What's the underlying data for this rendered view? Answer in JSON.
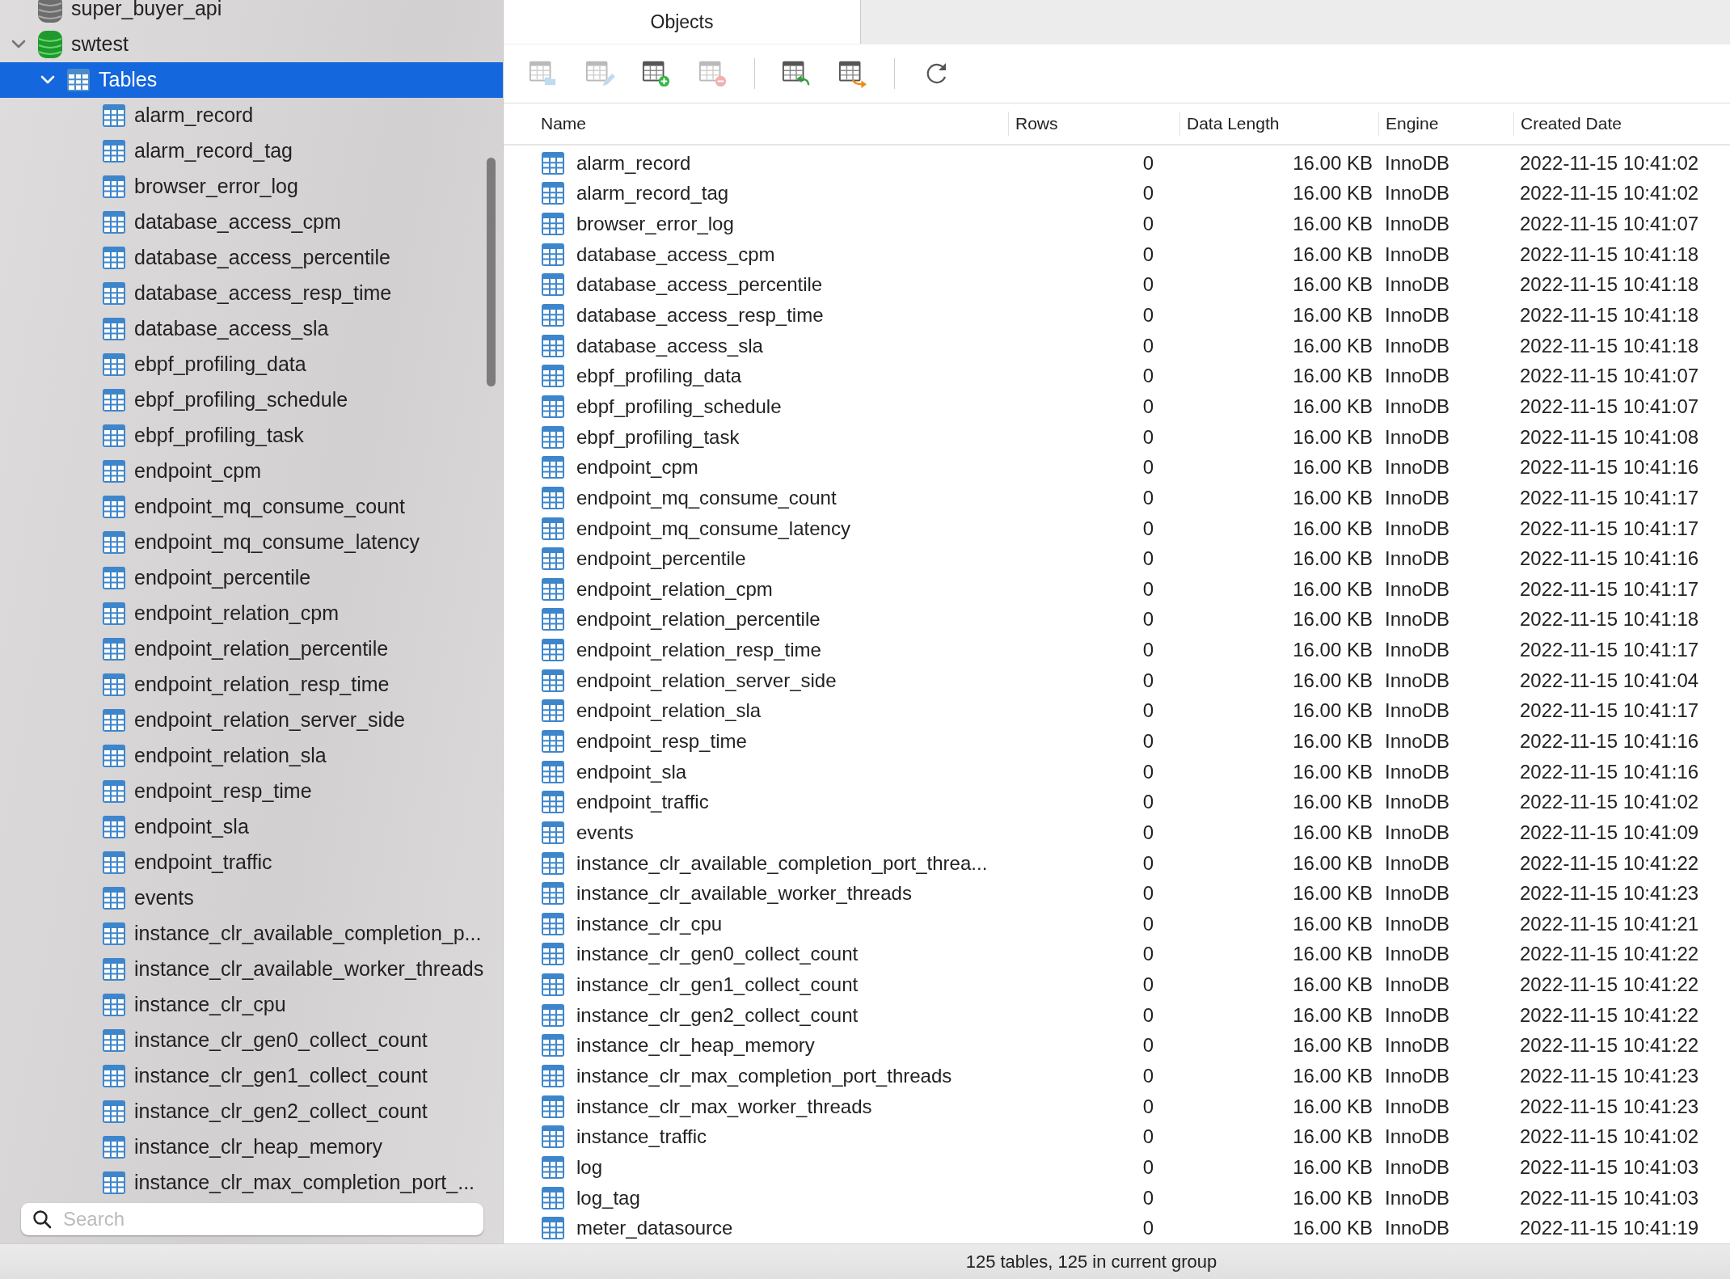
{
  "sidebar": {
    "tree": [
      {
        "name": "super_buyer_api",
        "kind": "database",
        "open": false,
        "selected": false
      },
      {
        "name": "swtest",
        "kind": "database",
        "open": true,
        "expanded": true,
        "selected": false,
        "children": [
          {
            "name": "Tables",
            "kind": "group",
            "expanded": true,
            "selected": true,
            "children": [
              {
                "name": "alarm_record",
                "kind": "table",
                "selected": false
              },
              {
                "name": "alarm_record_tag",
                "kind": "table",
                "selected": false
              },
              {
                "name": "browser_error_log",
                "kind": "table",
                "selected": false
              },
              {
                "name": "database_access_cpm",
                "kind": "table",
                "selected": false
              },
              {
                "name": "database_access_percentile",
                "kind": "table",
                "selected": false
              },
              {
                "name": "database_access_resp_time",
                "kind": "table",
                "selected": false
              },
              {
                "name": "database_access_sla",
                "kind": "table",
                "selected": false
              },
              {
                "name": "ebpf_profiling_data",
                "kind": "table",
                "selected": false
              },
              {
                "name": "ebpf_profiling_schedule",
                "kind": "table",
                "selected": false
              },
              {
                "name": "ebpf_profiling_task",
                "kind": "table",
                "selected": false
              },
              {
                "name": "endpoint_cpm",
                "kind": "table",
                "selected": false
              },
              {
                "name": "endpoint_mq_consume_count",
                "kind": "table",
                "selected": false
              },
              {
                "name": "endpoint_mq_consume_latency",
                "kind": "table",
                "selected": false
              },
              {
                "name": "endpoint_percentile",
                "kind": "table",
                "selected": false
              },
              {
                "name": "endpoint_relation_cpm",
                "kind": "table",
                "selected": false
              },
              {
                "name": "endpoint_relation_percentile",
                "kind": "table",
                "selected": false
              },
              {
                "name": "endpoint_relation_resp_time",
                "kind": "table",
                "selected": false
              },
              {
                "name": "endpoint_relation_server_side",
                "kind": "table",
                "selected": false
              },
              {
                "name": "endpoint_relation_sla",
                "kind": "table",
                "selected": false
              },
              {
                "name": "endpoint_resp_time",
                "kind": "table",
                "selected": false
              },
              {
                "name": "endpoint_sla",
                "kind": "table",
                "selected": false
              },
              {
                "name": "endpoint_traffic",
                "kind": "table",
                "selected": false
              },
              {
                "name": "events",
                "kind": "table",
                "selected": false
              },
              {
                "name": "instance_clr_available_completion_p...",
                "kind": "table",
                "selected": false
              },
              {
                "name": "instance_clr_available_worker_threads",
                "kind": "table",
                "selected": false
              },
              {
                "name": "instance_clr_cpu",
                "kind": "table",
                "selected": false
              },
              {
                "name": "instance_clr_gen0_collect_count",
                "kind": "table",
                "selected": false
              },
              {
                "name": "instance_clr_gen1_collect_count",
                "kind": "table",
                "selected": false
              },
              {
                "name": "instance_clr_gen2_collect_count",
                "kind": "table",
                "selected": false
              },
              {
                "name": "instance_clr_heap_memory",
                "kind": "table",
                "selected": false
              },
              {
                "name": "instance_clr_max_completion_port_...",
                "kind": "table",
                "selected": false
              }
            ]
          }
        ]
      }
    ],
    "search": {
      "placeholder": "Search"
    }
  },
  "tabs": [
    {
      "label": "Objects",
      "selected": true
    }
  ],
  "toolbar": [
    {
      "kind": "open",
      "disabled": true
    },
    {
      "kind": "design",
      "disabled": true
    },
    {
      "kind": "new",
      "disabled": false
    },
    {
      "kind": "delete",
      "disabled": true
    },
    {
      "kind": "separator"
    },
    {
      "kind": "import",
      "disabled": false
    },
    {
      "kind": "export",
      "disabled": false
    },
    {
      "kind": "separator"
    },
    {
      "kind": "refresh",
      "disabled": false
    }
  ],
  "table": {
    "columns": [
      "Name",
      "Rows",
      "Data Length",
      "Engine",
      "Created Date"
    ],
    "rows": [
      [
        "alarm_record",
        "0",
        "16.00 KB",
        "InnoDB",
        "2022-11-15 10:41:02"
      ],
      [
        "alarm_record_tag",
        "0",
        "16.00 KB",
        "InnoDB",
        "2022-11-15 10:41:02"
      ],
      [
        "browser_error_log",
        "0",
        "16.00 KB",
        "InnoDB",
        "2022-11-15 10:41:07"
      ],
      [
        "database_access_cpm",
        "0",
        "16.00 KB",
        "InnoDB",
        "2022-11-15 10:41:18"
      ],
      [
        "database_access_percentile",
        "0",
        "16.00 KB",
        "InnoDB",
        "2022-11-15 10:41:18"
      ],
      [
        "database_access_resp_time",
        "0",
        "16.00 KB",
        "InnoDB",
        "2022-11-15 10:41:18"
      ],
      [
        "database_access_sla",
        "0",
        "16.00 KB",
        "InnoDB",
        "2022-11-15 10:41:18"
      ],
      [
        "ebpf_profiling_data",
        "0",
        "16.00 KB",
        "InnoDB",
        "2022-11-15 10:41:07"
      ],
      [
        "ebpf_profiling_schedule",
        "0",
        "16.00 KB",
        "InnoDB",
        "2022-11-15 10:41:07"
      ],
      [
        "ebpf_profiling_task",
        "0",
        "16.00 KB",
        "InnoDB",
        "2022-11-15 10:41:08"
      ],
      [
        "endpoint_cpm",
        "0",
        "16.00 KB",
        "InnoDB",
        "2022-11-15 10:41:16"
      ],
      [
        "endpoint_mq_consume_count",
        "0",
        "16.00 KB",
        "InnoDB",
        "2022-11-15 10:41:17"
      ],
      [
        "endpoint_mq_consume_latency",
        "0",
        "16.00 KB",
        "InnoDB",
        "2022-11-15 10:41:17"
      ],
      [
        "endpoint_percentile",
        "0",
        "16.00 KB",
        "InnoDB",
        "2022-11-15 10:41:16"
      ],
      [
        "endpoint_relation_cpm",
        "0",
        "16.00 KB",
        "InnoDB",
        "2022-11-15 10:41:17"
      ],
      [
        "endpoint_relation_percentile",
        "0",
        "16.00 KB",
        "InnoDB",
        "2022-11-15 10:41:18"
      ],
      [
        "endpoint_relation_resp_time",
        "0",
        "16.00 KB",
        "InnoDB",
        "2022-11-15 10:41:17"
      ],
      [
        "endpoint_relation_server_side",
        "0",
        "16.00 KB",
        "InnoDB",
        "2022-11-15 10:41:04"
      ],
      [
        "endpoint_relation_sla",
        "0",
        "16.00 KB",
        "InnoDB",
        "2022-11-15 10:41:17"
      ],
      [
        "endpoint_resp_time",
        "0",
        "16.00 KB",
        "InnoDB",
        "2022-11-15 10:41:16"
      ],
      [
        "endpoint_sla",
        "0",
        "16.00 KB",
        "InnoDB",
        "2022-11-15 10:41:16"
      ],
      [
        "endpoint_traffic",
        "0",
        "16.00 KB",
        "InnoDB",
        "2022-11-15 10:41:02"
      ],
      [
        "events",
        "0",
        "16.00 KB",
        "InnoDB",
        "2022-11-15 10:41:09"
      ],
      [
        "instance_clr_available_completion_port_threa...",
        "0",
        "16.00 KB",
        "InnoDB",
        "2022-11-15 10:41:22"
      ],
      [
        "instance_clr_available_worker_threads",
        "0",
        "16.00 KB",
        "InnoDB",
        "2022-11-15 10:41:23"
      ],
      [
        "instance_clr_cpu",
        "0",
        "16.00 KB",
        "InnoDB",
        "2022-11-15 10:41:21"
      ],
      [
        "instance_clr_gen0_collect_count",
        "0",
        "16.00 KB",
        "InnoDB",
        "2022-11-15 10:41:22"
      ],
      [
        "instance_clr_gen1_collect_count",
        "0",
        "16.00 KB",
        "InnoDB",
        "2022-11-15 10:41:22"
      ],
      [
        "instance_clr_gen2_collect_count",
        "0",
        "16.00 KB",
        "InnoDB",
        "2022-11-15 10:41:22"
      ],
      [
        "instance_clr_heap_memory",
        "0",
        "16.00 KB",
        "InnoDB",
        "2022-11-15 10:41:22"
      ],
      [
        "instance_clr_max_completion_port_threads",
        "0",
        "16.00 KB",
        "InnoDB",
        "2022-11-15 10:41:23"
      ],
      [
        "instance_clr_max_worker_threads",
        "0",
        "16.00 KB",
        "InnoDB",
        "2022-11-15 10:41:23"
      ],
      [
        "instance_traffic",
        "0",
        "16.00 KB",
        "InnoDB",
        "2022-11-15 10:41:02"
      ],
      [
        "log",
        "0",
        "16.00 KB",
        "InnoDB",
        "2022-11-15 10:41:03"
      ],
      [
        "log_tag",
        "0",
        "16.00 KB",
        "InnoDB",
        "2022-11-15 10:41:03"
      ],
      [
        "meter_datasource",
        "0",
        "16.00 KB",
        "InnoDB",
        "2022-11-15 10:41:19"
      ]
    ]
  },
  "status_bar": "125 tables, 125 in current group"
}
